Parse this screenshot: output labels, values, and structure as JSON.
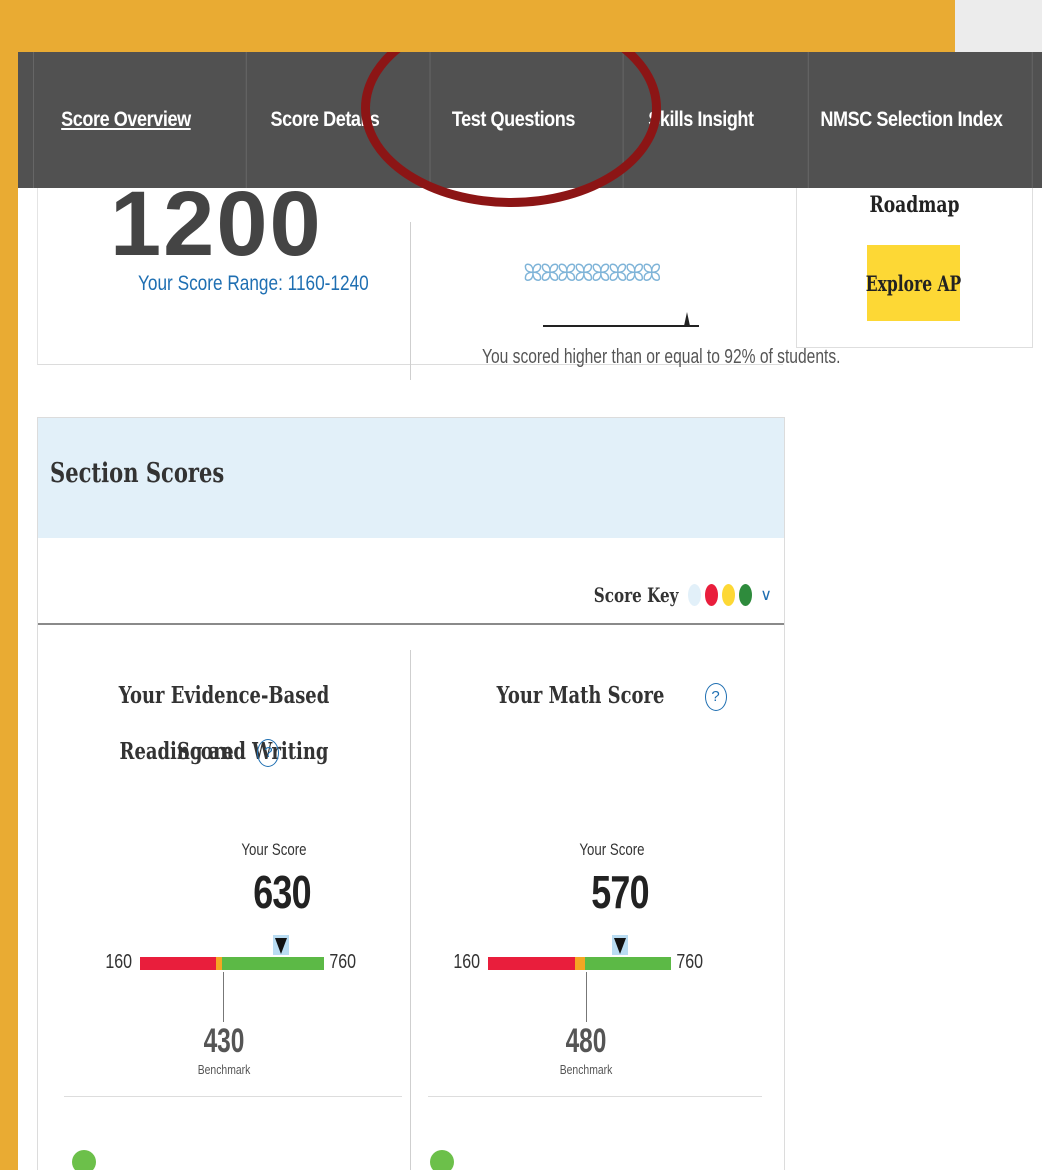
{
  "nav": {
    "tabs": [
      {
        "label": "Score Overview",
        "active": true
      },
      {
        "label": "Score Details",
        "active": false
      },
      {
        "label": "Test Questions",
        "active": false
      },
      {
        "label": "Skills Insight",
        "active": false
      },
      {
        "label": "NMSC Selection Index",
        "active": false
      }
    ]
  },
  "total": {
    "score": "1200",
    "range": "Your Score Range: 1160-1240",
    "percentile_text": "You scored higher than or equal to 92% of students."
  },
  "ap": {
    "roadmap": "Roadmap",
    "explore_label": "Explore AP"
  },
  "section_scores": {
    "title": "Section Scores",
    "score_key_label": "Score Key",
    "key_colors": [
      "#e2f0f9",
      "#e91e3c",
      "#fdd835",
      "#2e8b3c"
    ],
    "columns": [
      {
        "title_line1": "Your Evidence-Based Reading and Writing",
        "title_line2": "Score",
        "your_score_label": "Your Score",
        "score": "630",
        "min": "160",
        "max": "760",
        "benchmark": "430",
        "benchmark_label": "Benchmark"
      },
      {
        "title_line1": "Your Math Score",
        "title_line2": "",
        "your_score_label": "Your Score",
        "score": "570",
        "min": "160",
        "max": "760",
        "benchmark": "480",
        "benchmark_label": "Benchmark"
      }
    ]
  },
  "colors": {
    "nav_bg": "#515151",
    "accent_blue": "#1f6fb2",
    "annotation": "#8c1515",
    "frame": "#e9ab33"
  }
}
